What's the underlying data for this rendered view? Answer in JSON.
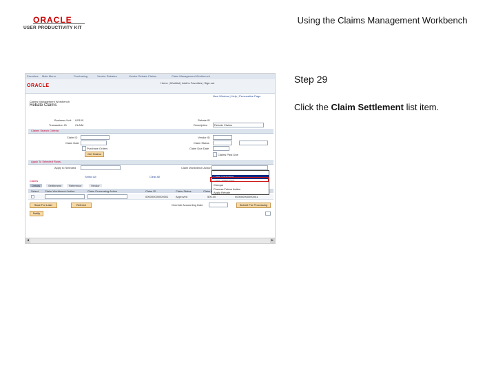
{
  "header": {
    "logo_brand": "ORACLE",
    "logo_product": "USER PRODUCTIVITY KIT",
    "slide_title": "Using the Claims Management Workbench"
  },
  "instructions": {
    "step": "Step 29",
    "text_before": "Click the ",
    "text_bold": "Claim Settlement",
    "text_after": " list item."
  },
  "screenshot": {
    "nav": [
      "Favorites",
      "Main Menu",
      "Purchasing",
      "Vendor Rebates",
      "Vendor Rebate Claims",
      "Claim Management Workbench"
    ],
    "brand": "ORACLE",
    "header_links": "Home | Worklist | Add to Favorites | Sign out",
    "page_links": "New Window | Help | Personalize Page",
    "breadcrumb": "Claims Management Workbench",
    "page_title": "Rebate Claims",
    "fields": {
      "business_unit_label": "Business Unit",
      "business_unit_value": "US100",
      "transaction_id_label": "Transaction ID",
      "transaction_id_value": "CLAIM",
      "rebate_id_label": "Rebate ID",
      "description_label": "Description",
      "description_value": "Rebate Claims",
      "claim_id_label": "Claim ID",
      "claim_date_label": "Claim Date",
      "vendor_id_label": "Vendor ID",
      "claim_status_label": "Claim Status",
      "purchase_orders_label": "Purchase Orders",
      "claim_due_date_label": "Claim Due Date",
      "claims_past_due_label": "Claims Past Due"
    },
    "sections": {
      "search": "Claims Search Criteria",
      "apply": "Apply To Selected Rows"
    },
    "buttons": {
      "search": "Get Claims",
      "select_all": "Select All",
      "clear_all": "Clear All",
      "save_for_later": "Save For Later",
      "refresh": "Refresh",
      "submit": "Submit For Processing",
      "notify": "Notify"
    },
    "apply_labels": {
      "left": "Apply to Selected",
      "right": "Claim Workbench Action"
    },
    "grid": {
      "title": "Claims",
      "tabs": [
        "Details",
        "Settlement",
        "Reference",
        "Vendor"
      ],
      "columns": [
        "Select",
        "Claim Workbench Action",
        "Claim Processing Action",
        "Claim ID",
        "Claim Status",
        "Claim Amount",
        "Claim Date"
      ],
      "row": [
        "",
        "",
        "",
        "000000000000001",
        "Approved",
        "500.00",
        "000000000000001"
      ]
    },
    "override_label": "Override Accounting Date",
    "dropdown_items": [
      "",
      "Claim Deduction",
      "Claim Settlement",
      "Cheque",
      "Process Future Action",
      "Apply Rebate"
    ],
    "dropdown_selected": "Claim Deduction"
  }
}
